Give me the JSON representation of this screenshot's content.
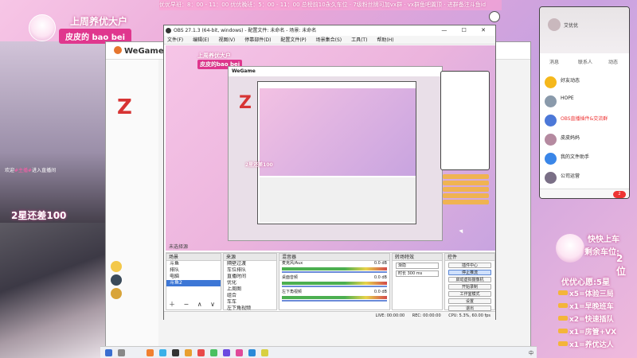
{
  "banner": {
    "text": "优优早班：8：00 - 11：00   优优晚班：5：00 - 11：00   总榜前10永久车位 · 7级粉丝牌可加vx群 · vx群鱼吧置顶 · 进群备注斗鱼id"
  },
  "streamer": {
    "title": "上周养优大户",
    "name": "皮皮的 bao bei"
  },
  "left_scene": {
    "chat_prefix": "欢迎",
    "chat_highlight": "#主播#",
    "chat_suffix": "进入直播间",
    "stars_message": "2星还差100"
  },
  "wegame": {
    "logo": "WeGame",
    "z_mark": "Z"
  },
  "obs": {
    "title": "OBS 27.1.3 (64-bit, windows) - 配置文件: 未命名 - 场景: 未命名",
    "window_controls": "—  ☐  ✕",
    "menu": [
      "文件(F)",
      "编辑(E)",
      "视图(V)",
      "停靠部件(D)",
      "配置文件(P)",
      "场景集合(S)",
      "工具(T)",
      "帮助(H)"
    ],
    "preview": {
      "streamer_title": "上周养优大户",
      "streamer_name": "皮皮的bao bei",
      "wegame_logo": "WeGame",
      "z_mark": "Z",
      "stars": "2星还差100"
    },
    "source_bar_label": "未选择源",
    "docks": {
      "scenes": {
        "title": "场景",
        "items": [
          "斗鱼",
          "排队",
          "电脑",
          "斗鱼2"
        ],
        "selected": 3
      },
      "sources": {
        "title": "来源",
        "items": [
          "隔壁过渡",
          "车位排队",
          "直播时间",
          "优化",
          "上周图",
          "组合",
          "车车",
          "左下角视频"
        ]
      },
      "mixer": {
        "title": "混音器",
        "channels": [
          {
            "name": "麦克风/Aux",
            "level": "0.0 dB"
          },
          {
            "name": "桌面音频",
            "level": "0.0 dB"
          },
          {
            "name": "左下角视频",
            "level": "0.0 dB"
          }
        ]
      },
      "transitions": {
        "title": "转场特效",
        "type": "渐隐",
        "duration_label": "时长",
        "duration_value": "300 ms"
      },
      "controls": {
        "title": "控件",
        "buttons": [
          "插件中心",
          "停止推流",
          "启动虚拟摄像机",
          "开始录制",
          "工作室模式",
          "设置",
          "退出"
        ]
      }
    },
    "status": {
      "live": "LIVE: 00:00:00",
      "rec": "REC: 00:00:00",
      "cpu": "CPU: 5.3%, 60.00 fps"
    }
  },
  "phone": {
    "user_name": "艾优优",
    "tabs": [
      "消息",
      "联系人",
      "动态"
    ],
    "items": [
      {
        "name": "好友动态",
        "msg": "",
        "color": "#f5b81c"
      },
      {
        "name": "HOPE",
        "msg": "",
        "color": "#8a9aab"
      },
      {
        "name": "OBS直播插件&交流群",
        "msg": "",
        "color": "#4c78d8"
      },
      {
        "name": "皮皮妈妈",
        "msg": "",
        "color": "#b58aa0"
      },
      {
        "name": "我的文件助手",
        "msg": "",
        "color": "#3a86e8"
      },
      {
        "name": "公司运营",
        "msg": "",
        "color": "#7a6f86"
      }
    ],
    "badge": "2"
  },
  "queue": {
    "title": "快快上车",
    "subtitle": "剩余车位:",
    "position": "2 位"
  },
  "rules": {
    "title": "优优心愿:5星",
    "lines": [
      "x5=体验三局",
      "x1=早晚班车",
      "x2=快速插队",
      "x1=房管+VX",
      "x1=养优达人"
    ]
  },
  "taskbar": {
    "tray": "中"
  }
}
